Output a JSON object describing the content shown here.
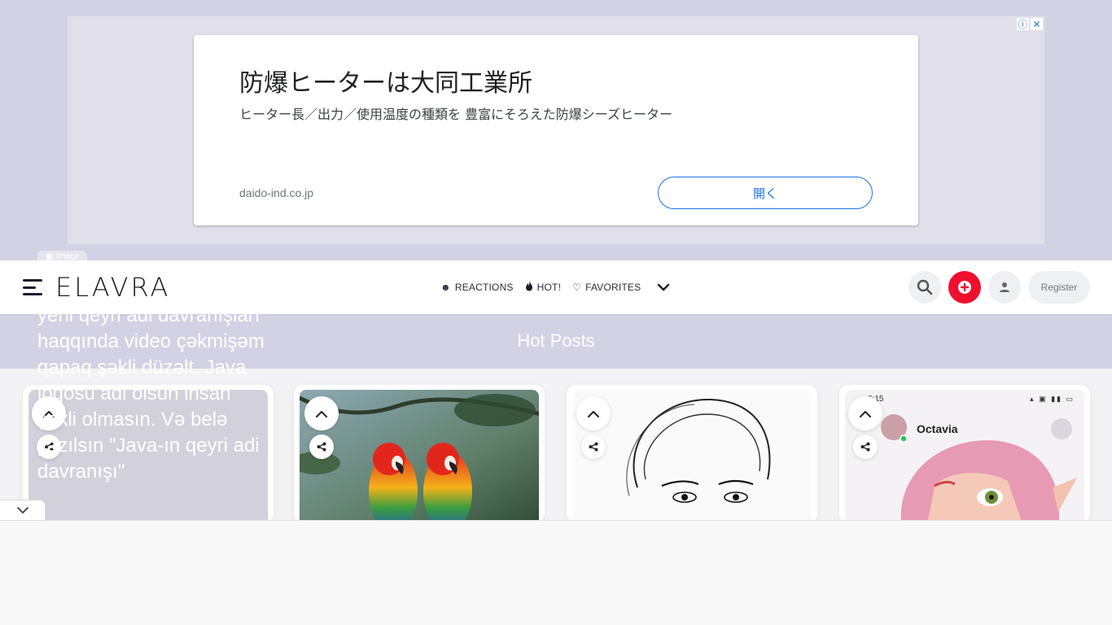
{
  "ad": {
    "title": "防爆ヒーターは大同工業所",
    "description": "ヒーター長／出力／使用温度の種類を 豊富にそろえた防爆シーズヒーター",
    "domain": "daido-ind.co.jp",
    "open_label": "開く",
    "info_icon": "info-icon",
    "close_icon": "close-icon"
  },
  "image_tag": {
    "label": "Image"
  },
  "header": {
    "logo": "ELAVRA",
    "nav": [
      {
        "label": "REACTIONS",
        "icon": "reaction-face-icon"
      },
      {
        "label": "HOT!",
        "icon": "flame-icon"
      },
      {
        "label": "FAVORITES",
        "icon": "heart-icon"
      }
    ],
    "register_label": "Register"
  },
  "section": {
    "title": "Hot Posts"
  },
  "posts": [
    {
      "overflow_text": "yeni qeyri adi davranışları haqqında video çəkmişəm qapaq şəkli düzəlt. Java loqosu adi olsun insan şəkli olmasın. Və belə yazılsın \"Java-ın qeyri adi davranışı\""
    },
    {
      "image": "parrots"
    },
    {
      "image": "sketch-woman"
    },
    {
      "username": "Octavia",
      "status_time": "6:15"
    }
  ],
  "colors": {
    "accent_red": "#ef0f2f",
    "band_bg": "#d3d2e4",
    "ad_link_blue": "#1a73e8"
  }
}
